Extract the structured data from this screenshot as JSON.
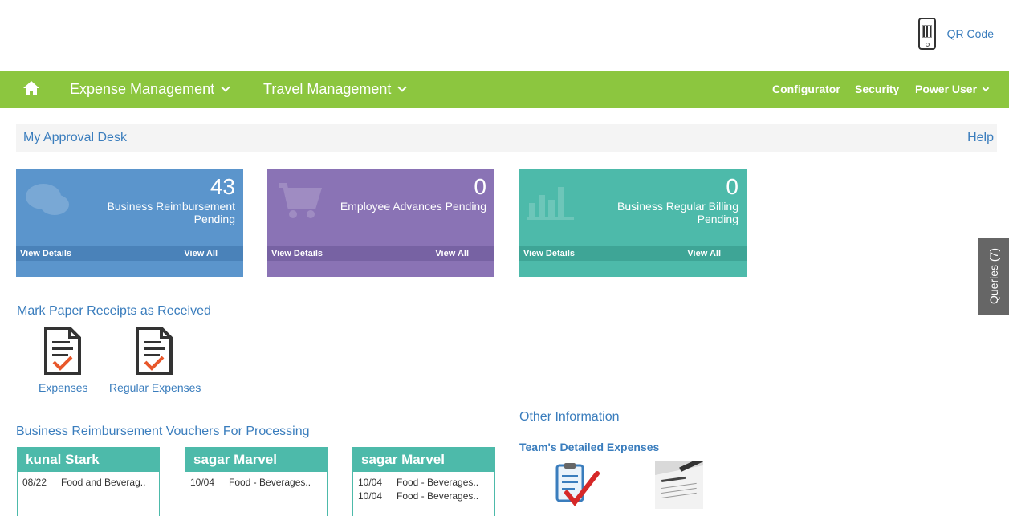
{
  "header": {
    "qr_label": "QR Code"
  },
  "nav": {
    "home_icon": "home-icon",
    "items": [
      {
        "label": "Expense Management"
      },
      {
        "label": "Travel Management"
      }
    ],
    "right": [
      {
        "label": "Configurator"
      },
      {
        "label": "Security"
      },
      {
        "label": "Power User"
      }
    ]
  },
  "desk": {
    "title": "My Approval Desk",
    "help": "Help"
  },
  "tiles": [
    {
      "count": "43",
      "label": "Business Reimbursement Pending",
      "view_details": "View Details",
      "view_all": "View All",
      "icon": "chat-icon",
      "color": "#5b95cc"
    },
    {
      "count": "0",
      "label": "Employee Advances Pending",
      "view_details": "View Details",
      "view_all": "View All",
      "icon": "cart-icon",
      "color": "#8a73b5"
    },
    {
      "count": "0",
      "label": "Business Regular Billing Pending",
      "view_details": "View Details",
      "view_all": "View All",
      "icon": "bar-chart-icon",
      "color": "#4dbaaa"
    }
  ],
  "queries": {
    "label": "Queries (7)"
  },
  "receipts": {
    "title": "Mark Paper Receipts as Received",
    "items": [
      {
        "label": "Expenses"
      },
      {
        "label": "Regular Expenses"
      }
    ]
  },
  "vouchers": {
    "title": "Business Reimbursement Vouchers For Processing",
    "cards": [
      {
        "name": "kunal Stark",
        "rows": [
          {
            "date": "08/22",
            "text": "Food and Beverag.."
          }
        ]
      },
      {
        "name": "sagar Marvel",
        "rows": [
          {
            "date": "10/04",
            "text": "Food - Beverages.."
          }
        ]
      },
      {
        "name": "sagar Marvel",
        "rows": [
          {
            "date": "10/04",
            "text": "Food - Beverages.."
          },
          {
            "date": "10/04",
            "text": "Food - Beverages.."
          }
        ]
      }
    ]
  },
  "other": {
    "title": "Other Information",
    "team_title": "Team's Detailed Expenses"
  }
}
